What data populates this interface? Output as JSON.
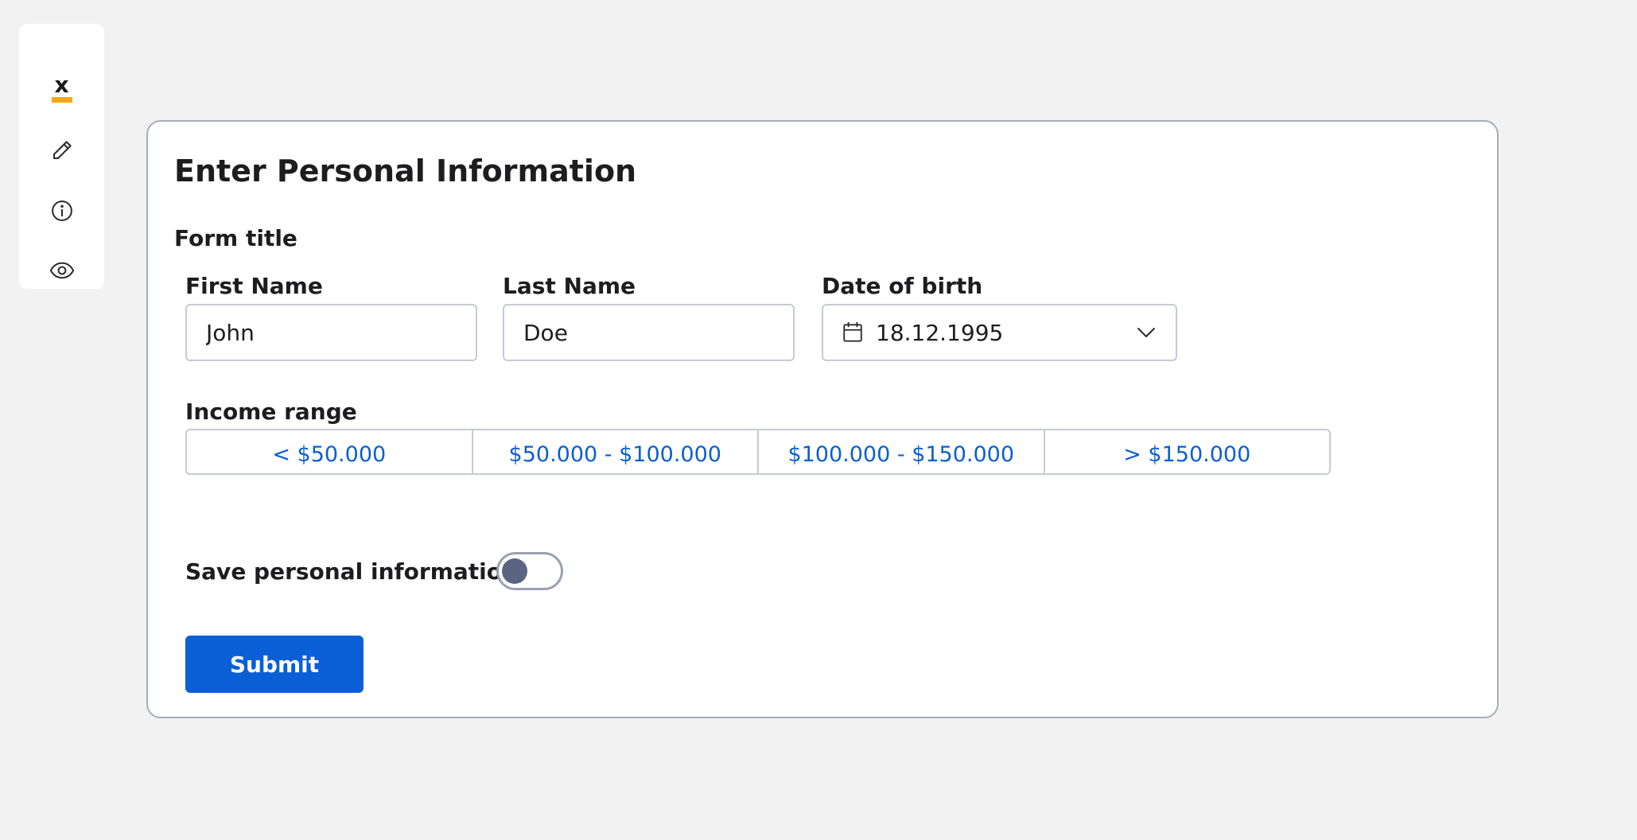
{
  "sidebar": {
    "logo_text": "x",
    "items": [
      {
        "icon": "pencil-icon"
      },
      {
        "icon": "info-icon"
      },
      {
        "icon": "eye-icon"
      }
    ]
  },
  "page": {
    "title": "Enter Personal Information",
    "form_title": "Form title"
  },
  "form": {
    "first_name": {
      "label": "First Name",
      "value": "John"
    },
    "last_name": {
      "label": "Last Name",
      "value": "Doe"
    },
    "dob": {
      "label": "Date of birth",
      "value": "18.12.1995"
    },
    "income": {
      "label": "Income range",
      "options": [
        "< $50.000",
        "$50.000 - $100.000",
        "$100.000 - $150.000",
        "> $150.000"
      ]
    },
    "save": {
      "label": "Save personal information",
      "enabled": false
    },
    "submit_label": "Submit"
  },
  "colors": {
    "accent": "#0b5fd6",
    "link": "#0a5fcf",
    "logo_bar": "#f5a71c",
    "toggle_knob": "#5b6581"
  }
}
